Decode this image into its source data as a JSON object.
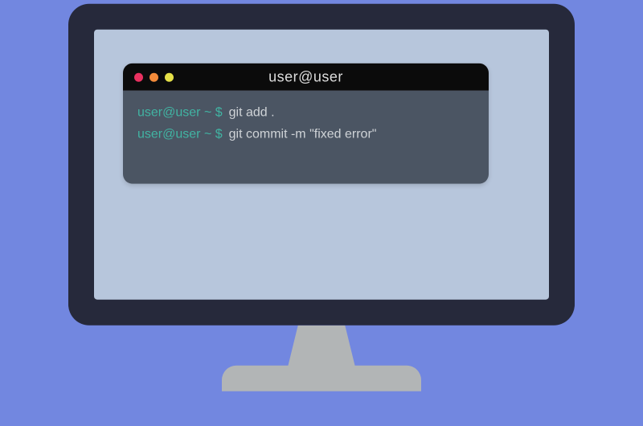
{
  "terminal": {
    "title": "user@user",
    "traffic_lights": [
      "red",
      "orange",
      "yellow"
    ],
    "lines": [
      {
        "prompt": "user@user ~ $",
        "command": "git add ."
      },
      {
        "prompt": "user@user ~ $",
        "command": "git commit -m \"fixed error\""
      }
    ]
  },
  "colors": {
    "background": "#7287e0",
    "monitor_bezel": "#26293b",
    "screen": "#b7c6dc",
    "stand": "#b2b5b6",
    "titlebar": "#0b0b0b",
    "term_body": "#4b5563",
    "prompt": "#41b4a3",
    "cmd_text": "#cfd3d7"
  }
}
